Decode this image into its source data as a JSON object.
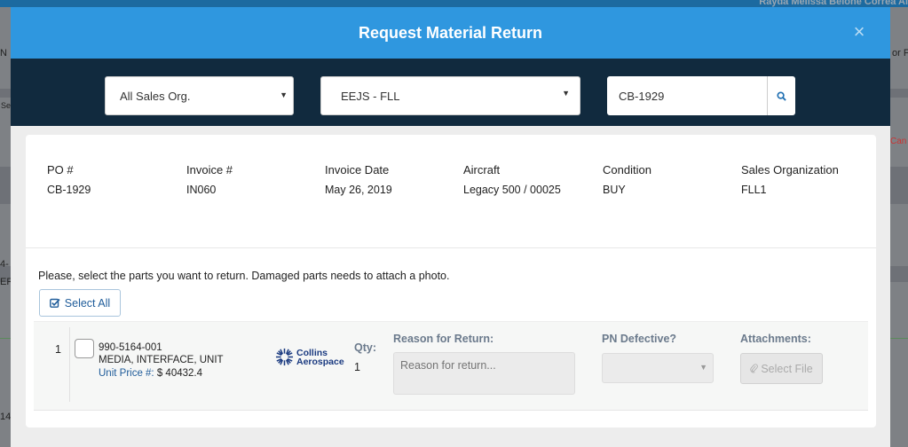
{
  "background": {
    "user_name": "Rayda Melissa Belone Correa Al",
    "fragments": [
      "N",
      "or F",
      "Se",
      "Can",
      "4-",
      "ER",
      "14"
    ]
  },
  "modal": {
    "title": "Request Material Return",
    "close_icon": "close-icon"
  },
  "filters": {
    "sales_org": "All Sales Org.",
    "location": "EEJS - FLL",
    "search_value": "CB-1929",
    "search_icon": "search-icon"
  },
  "invoice": {
    "columns": [
      {
        "label": "PO #",
        "value": "CB-1929"
      },
      {
        "label": "Invoice #",
        "value": "IN060"
      },
      {
        "label": "Invoice Date",
        "value": "May 26, 2019"
      },
      {
        "label": "Aircraft",
        "value": "Legacy 500 / 00025"
      },
      {
        "label": "Condition",
        "value": "BUY"
      },
      {
        "label": "Sales Organization",
        "value": "FLL1"
      }
    ]
  },
  "instruction": "Please, select the parts you want to return. Damaged parts needs to attach a photo.",
  "select_all_label": "Select All",
  "part": {
    "number": "1",
    "pn": "990-5164-001",
    "description": "MEDIA, INTERFACE, UNIT",
    "unit_price_label": "Unit Price #:",
    "unit_price": "$ 40432.4",
    "logo_line1": "Collins",
    "logo_line2": "Aerospace",
    "qty_label": "Qty:",
    "qty": "1",
    "reason_label": "Reason for Return:",
    "reason_placeholder": "Reason for return...",
    "defective_label": "PN Defective?",
    "attachments_label": "Attachments:",
    "select_file_label": "Select File"
  }
}
